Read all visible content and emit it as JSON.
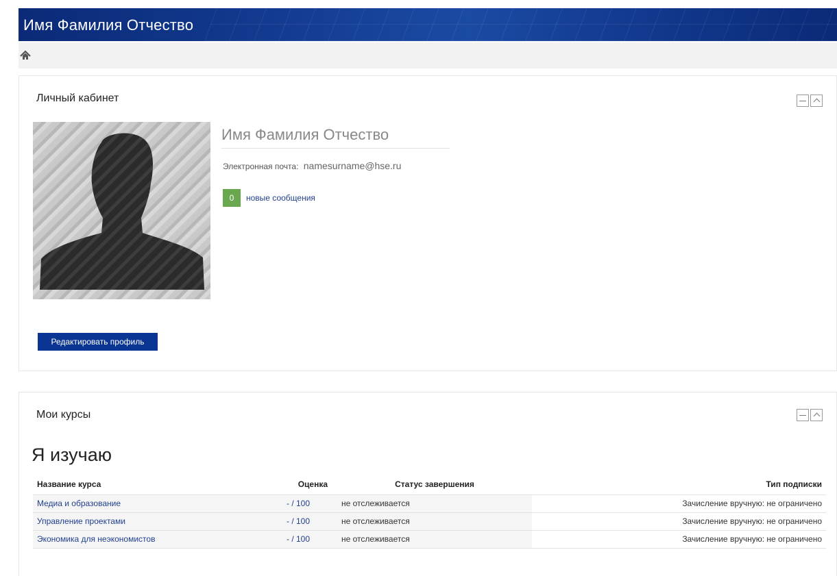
{
  "header": {
    "title": "Имя Фамилия Отчество"
  },
  "nav": {
    "home_icon": "home-icon"
  },
  "profile": {
    "block_title": "Личный кабинет",
    "full_name": "Имя Фамилия Отчество",
    "email_label": "Электронная почта:",
    "email_value": "namesurname@hse.ru",
    "messages_count": "0",
    "messages_label": "новые сообщения",
    "edit_button": "Редактировать профиль"
  },
  "courses": {
    "block_title": "Мои курсы",
    "heading": "Я изучаю",
    "columns": [
      "Название курса",
      "Оценка",
      "Статус завершения",
      "Тип подписки"
    ],
    "rows": [
      {
        "name": "Медиа и образование",
        "grade": "- / 100",
        "status": "не отслеживается",
        "subscription": "Зачисление вручную: не ограничено"
      },
      {
        "name": "Управление проектами",
        "grade": "- / 100",
        "status": "не отслеживается",
        "subscription": "Зачисление вручную: не ограничено"
      },
      {
        "name": "Экономика для неэкономистов",
        "grade": "- / 100",
        "status": "не отслеживается",
        "subscription": "Зачисление вручную: не ограничено"
      }
    ]
  },
  "colors": {
    "header_bg": "#0b2a78",
    "button_bg": "#0b3593",
    "badge_bg": "#6aa84f",
    "link": "#1f3f8f"
  }
}
